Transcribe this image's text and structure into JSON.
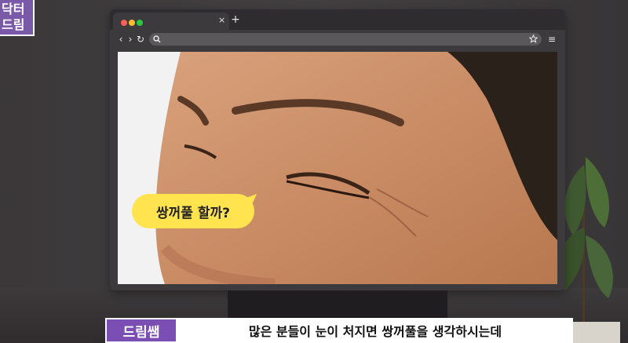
{
  "logo": {
    "line1": "닥터",
    "line2": "드림"
  },
  "browser": {
    "tab_close": "×",
    "new_tab": "+",
    "nav": {
      "back": "‹",
      "forward": "›",
      "reload": "↻"
    },
    "menu": "≡"
  },
  "video": {
    "bubble_text": "쌍꺼풀 할까?"
  },
  "subtitle": {
    "speaker": "드림쌤",
    "caption": "많은 분들이 눈이 처지면 쌍꺼풀을 생각하시는데"
  },
  "colors": {
    "logo_bg": "#7a5aa8",
    "speaker_bg": "#7a4eb3",
    "bubble_bg": "#ffe34f",
    "browser_bg": "#3c3a3c"
  },
  "icons": [
    "search-icon",
    "star-icon",
    "menu-icon",
    "back-icon",
    "forward-icon",
    "reload-icon",
    "close-icon",
    "plus-icon"
  ]
}
